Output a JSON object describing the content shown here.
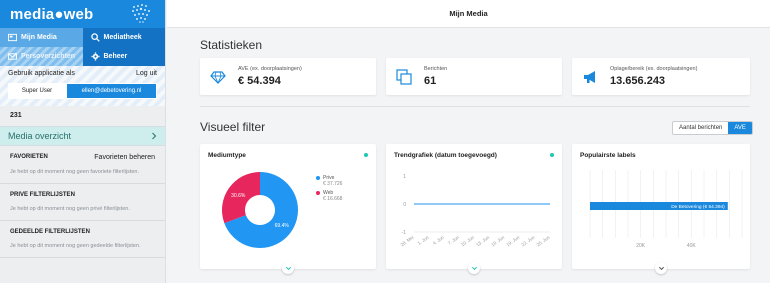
{
  "sidebar": {
    "brand": "media●web",
    "nav": [
      {
        "label": "Mijn Media",
        "icon": "media-icon"
      },
      {
        "label": "Mediatheek",
        "icon": "search-icon"
      },
      {
        "label": "Persoverzichten",
        "icon": "mail-icon"
      },
      {
        "label": "Beheer",
        "icon": "gear-icon"
      }
    ],
    "use_as": "Gebruik applicatie als",
    "logout": "Log uit",
    "role": "Super User",
    "email": "ellen@debetovering.nl",
    "count": "231",
    "media_overview": "Media overzicht",
    "favorites": {
      "title": "FAVORIETEN",
      "link": "Favorieten beheren",
      "text": "Je hebt op dit moment nog geen favoriete filterlijsten."
    },
    "private": {
      "title": "PRIVE FILTERLIJSTEN",
      "text": "Je hebt op dit moment nog geen privé filterlijsten."
    },
    "shared": {
      "title": "GEDEELDE FILTERLIJSTEN",
      "text": "Je hebt op dit moment nog geen gedeelde filterlijsten."
    }
  },
  "header": {
    "title": "Mijn Media"
  },
  "stats": {
    "title": "Statistieken",
    "cards": [
      {
        "label": "AVE (ex. doorplaatsingen)",
        "value": "€ 54.394",
        "icon": "diamond-icon"
      },
      {
        "label": "Berichten",
        "value": "61",
        "icon": "copy-icon"
      },
      {
        "label": "Oplage/bereik (ex. doorplaatsingen)",
        "value": "13.656.243",
        "icon": "megaphone-icon"
      }
    ]
  },
  "visual": {
    "title": "Visueel filter",
    "toggle": [
      "Aantal berichten",
      "AVE"
    ],
    "active_toggle": "AVE"
  },
  "colors": {
    "brand": "#1a88dd",
    "prive": "#2196f3",
    "web": "#e8265e",
    "accent": "#20c7b2"
  },
  "chart_data": [
    {
      "type": "pie",
      "title": "Mediumtype",
      "slices": [
        {
          "name": "Prive",
          "value": 69.4,
          "amount": "€ 37.726"
        },
        {
          "name": "Web",
          "value": 30.6,
          "amount": "€ 16.668"
        }
      ],
      "labels": [
        "69.4%",
        "30.6%"
      ]
    },
    {
      "type": "line",
      "title": "Trendgrafiek (datum toegevoegd)",
      "x": [
        "28. Mei",
        "1. Jun",
        "4. Jun",
        "7. Jun",
        "10. Jun",
        "13. Jun",
        "16. Jun",
        "19. Jun",
        "22. Jun",
        "25. Jun"
      ],
      "series": [
        {
          "values": [
            0,
            0,
            0,
            0,
            0,
            0,
            0,
            0,
            0,
            0
          ]
        }
      ],
      "yticks": [
        "1",
        "0",
        "-1"
      ],
      "ylim": [
        -1,
        1
      ]
    },
    {
      "type": "bar",
      "title": "Populairste labels",
      "categories": [
        "De Betovering"
      ],
      "values": [
        54394
      ],
      "bar_label": "De Betovering (€ 54.394)",
      "xticks": [
        "20K",
        "40K"
      ],
      "xlim": [
        0,
        60000
      ]
    }
  ]
}
